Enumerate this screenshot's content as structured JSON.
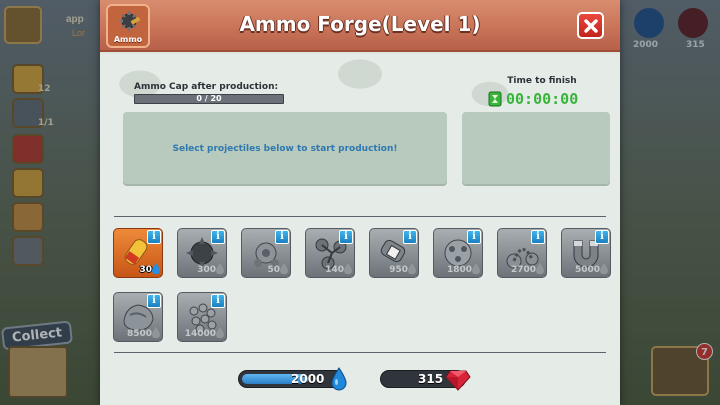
{
  "background": {
    "top_left_name": "app",
    "top_left_sub": "Lor",
    "side_counts": [
      "12",
      "1/1"
    ],
    "collect_label": "Collect",
    "water_value": "2000",
    "gem_value": "315",
    "chest_badge": "7"
  },
  "dialog": {
    "title": "Ammo Forge(Level 1)",
    "badge_label": "Ammo",
    "close_icon": "x-icon"
  },
  "production": {
    "cap_label": "Ammo Cap after production:",
    "cap_text": "0 / 20",
    "cap_current": 0,
    "cap_max": 20,
    "time_label": "Time to finish",
    "timer": "00:00:00",
    "queue_hint": "Select projectiles below to start production!"
  },
  "projectiles": [
    {
      "cost": "30",
      "active": true,
      "art": "rocket"
    },
    {
      "cost": "300",
      "active": false,
      "art": "spiked-ball"
    },
    {
      "cost": "50",
      "active": false,
      "art": "gear-ball"
    },
    {
      "cost": "140",
      "active": false,
      "art": "bolas"
    },
    {
      "cost": "950",
      "active": false,
      "art": "grenade"
    },
    {
      "cost": "1800",
      "active": false,
      "art": "disc"
    },
    {
      "cost": "2700",
      "active": false,
      "art": "chain-ball"
    },
    {
      "cost": "5000",
      "active": false,
      "art": "magnet"
    },
    {
      "cost": "8500",
      "active": false,
      "art": "boulder"
    },
    {
      "cost": "14000",
      "active": false,
      "art": "cluster"
    }
  ],
  "resources": {
    "water": "2000",
    "gems": "315"
  },
  "colors": {
    "header": "#c97459",
    "accent_blue": "#2f78b0",
    "timer_green": "#37b53a"
  }
}
